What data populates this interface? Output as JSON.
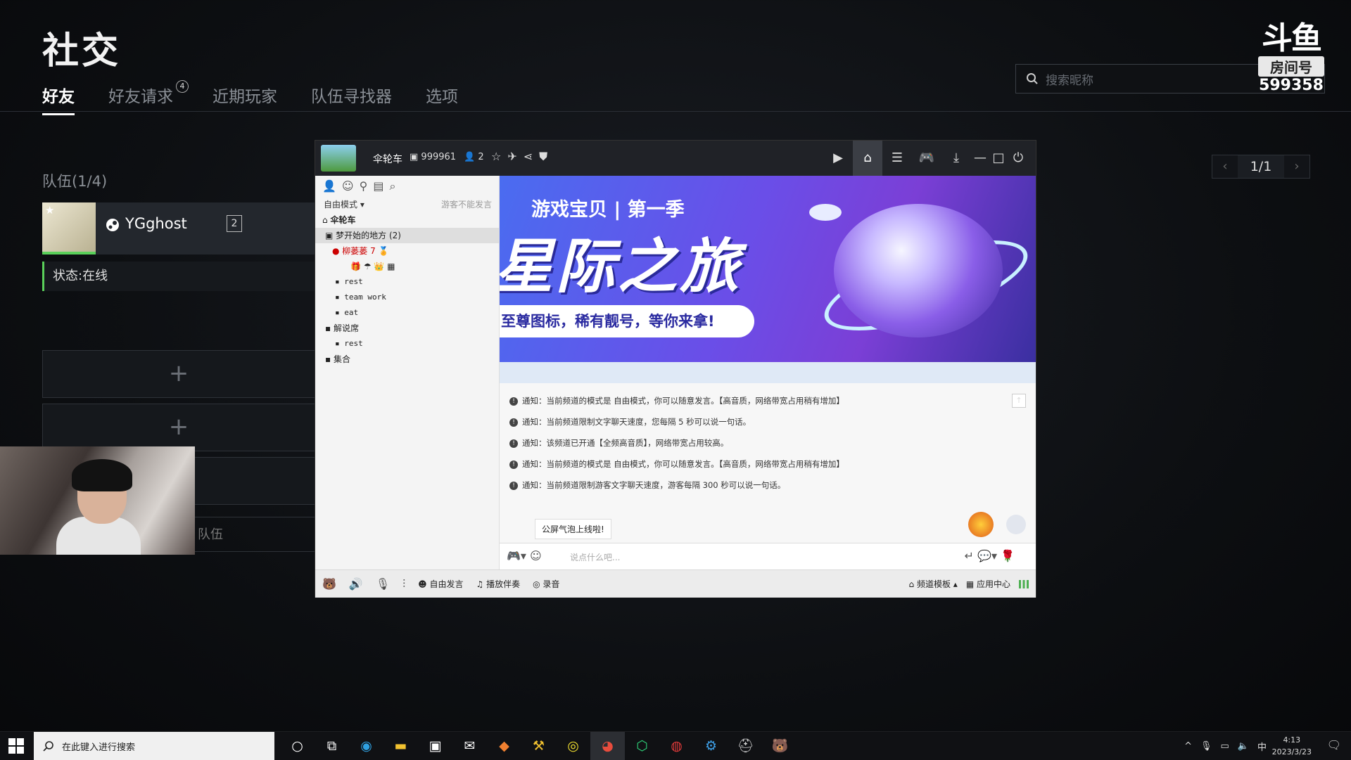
{
  "game": {
    "title": "社交",
    "tabs": [
      {
        "label": "好友",
        "active": true
      },
      {
        "label": "好友请求",
        "badge": "4"
      },
      {
        "label": "近期玩家"
      },
      {
        "label": "队伍寻找器"
      },
      {
        "label": "选项"
      }
    ],
    "search_placeholder": "搜索昵称",
    "team_label": "队伍(1/4)",
    "member": {
      "name": "YGghost",
      "level": "2",
      "status": "状态:在线"
    },
    "slot_plus": "+",
    "leave_label": "队伍",
    "pager": {
      "prev": "‹",
      "value": "1/1",
      "next": "›"
    }
  },
  "douyu": {
    "logo": "斗鱼",
    "room_label": "房间号",
    "room_number": "599358"
  },
  "yy": {
    "channel_name": "伞轮车",
    "channel_id": "999961",
    "online_count": "2",
    "mode_label": "自由模式 ▾",
    "guest_note": "游客不能发言",
    "tree": [
      {
        "label": "伞轮车",
        "indent": 10
      },
      {
        "label": "梦开始的地方 (2)",
        "indent": 14,
        "selected": true
      },
      {
        "label": "柳蒌蒌 7",
        "indent": 28
      },
      {
        "label": "rest",
        "indent": 28
      },
      {
        "label": "team work",
        "indent": 28
      },
      {
        "label": "eat",
        "indent": 28
      },
      {
        "label": "解说席",
        "indent": 14
      },
      {
        "label": "rest",
        "indent": 28
      },
      {
        "label": "集合",
        "indent": 14
      }
    ],
    "banner": {
      "top": "游戏宝贝 | 第一季",
      "big": "星际之旅",
      "sub": "至尊图标，稀有靓号，等你来拿!"
    },
    "notices": [
      "通知：当前频道的模式是 自由模式，你可以随意发言。【高音质，网络带宽占用稍有增加】",
      "通知：当前频道限制文字聊天速度，您每隔 5 秒可以说一句话。",
      "通知：该频道已开通【全频高音质】，网络带宽占用较高。",
      "通知：当前频道的模式是 自由模式，你可以随意发言。【高音质，网络带宽占用稍有增加】",
      "通知：当前频道限制游客文字聊天速度，游客每隔 300 秒可以说一句话。"
    ],
    "bubble": "公屏气泡上线啦!",
    "input_placeholder": "说点什么吧...",
    "bottom": {
      "speak_mode": "自由发言",
      "accompany": "播放伴奏",
      "record": "录音",
      "template": "频道模板 ▴",
      "app_center": "应用中心"
    }
  },
  "taskbar": {
    "search_placeholder": "在此键入进行搜索",
    "time": "4:13",
    "date": "2023/3/23",
    "ime": "中"
  }
}
